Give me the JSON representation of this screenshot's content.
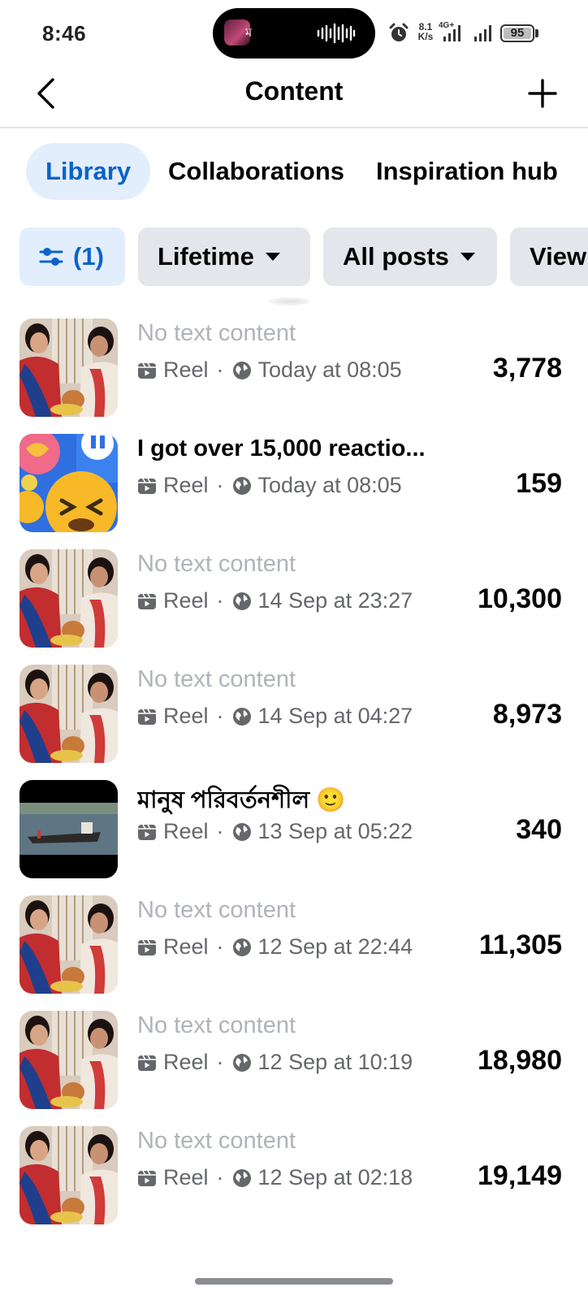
{
  "status_bar": {
    "time": "8:46",
    "island_letter": "ম",
    "net_speed_top": "8.1",
    "net_speed_bottom": "K/s",
    "network_type": "4G+",
    "battery": "95"
  },
  "header": {
    "title": "Content",
    "back_icon": "chevron-left-icon",
    "add_icon": "plus-icon"
  },
  "tabs": [
    {
      "label": "Library",
      "active": true
    },
    {
      "label": "Collaborations",
      "active": false
    },
    {
      "label": "Inspiration hub",
      "active": false
    }
  ],
  "filters": {
    "filter_count": "(1)",
    "filter_icon": "sliders-icon",
    "time_range": "Lifetime",
    "post_type": "All posts",
    "sort": "View"
  },
  "posts": [
    {
      "title": "No text content",
      "placeholder": true,
      "type": "Reel",
      "date": "Today at 08:05",
      "views": "3,778",
      "thumb": "saree-scene"
    },
    {
      "title": "I got over 15,000 reactio...",
      "placeholder": false,
      "type": "Reel",
      "date": "Today at 08:05",
      "views": "159",
      "thumb": "reaction-emojis"
    },
    {
      "title": "No text content",
      "placeholder": true,
      "type": "Reel",
      "date": "14 Sep at 23:27",
      "views": "10,300",
      "thumb": "saree-scene"
    },
    {
      "title": "No text content",
      "placeholder": true,
      "type": "Reel",
      "date": "14 Sep at 04:27",
      "views": "8,973",
      "thumb": "saree-scene"
    },
    {
      "title": "মানুষ পরিবর্তনশীল 🙂",
      "placeholder": false,
      "type": "Reel",
      "date": "13 Sep at 05:22",
      "views": "340",
      "thumb": "boat-river"
    },
    {
      "title": "No text content",
      "placeholder": true,
      "type": "Reel",
      "date": "12 Sep at 22:44",
      "views": "11,305",
      "thumb": "saree-scene"
    },
    {
      "title": "No text content",
      "placeholder": true,
      "type": "Reel",
      "date": "12 Sep at 10:19",
      "views": "18,980",
      "thumb": "saree-scene"
    },
    {
      "title": "No text content",
      "placeholder": true,
      "type": "Reel",
      "date": "12 Sep at 02:18",
      "views": "19,149",
      "thumb": "saree-scene"
    }
  ],
  "colors": {
    "accent": "#0a63c9",
    "accent_bg": "#e3eefc",
    "chip_bg": "#e4e6eb",
    "placeholder_text": "#b0b3b8",
    "meta_text": "#65676b"
  }
}
